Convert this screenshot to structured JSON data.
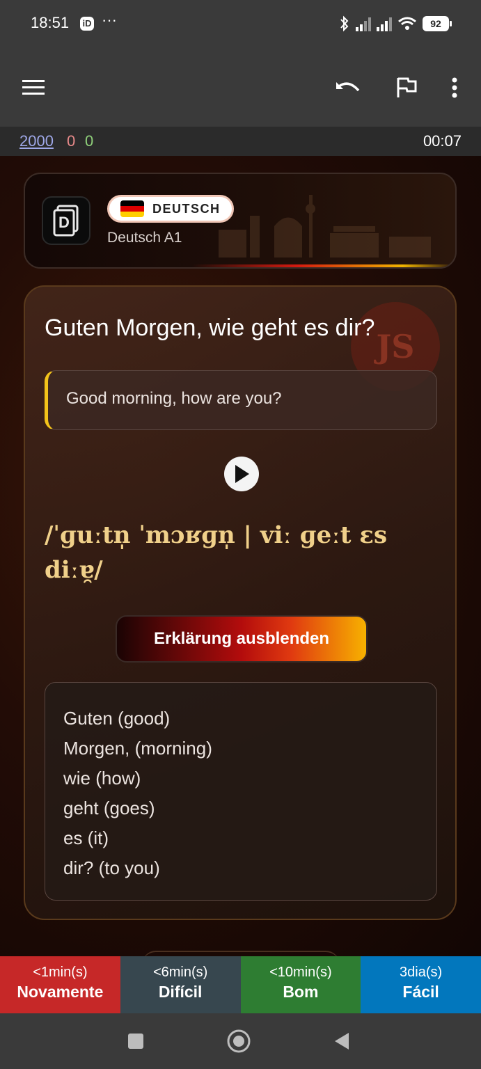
{
  "status_bar": {
    "time": "18:51",
    "app_badge": "iD",
    "more": "···",
    "battery": "92"
  },
  "app_bar": {
    "icons": [
      "menu-icon",
      "undo-icon",
      "flag-icon",
      "more-vert-icon"
    ]
  },
  "counters": {
    "new": "2000",
    "learning": "0",
    "review": "0",
    "timer": "00:07"
  },
  "deck": {
    "language": "DEUTSCH",
    "name": "Deutsch A1",
    "flag_colors": [
      "#000000",
      "#dd0000",
      "#ffce00"
    ]
  },
  "card": {
    "question": "Guten Morgen, wie geht es dir?",
    "translation": "Good morning, how are you?",
    "ipa": "/ˈɡuːtn̩ ˈmɔʁɡn̩ | viː ɡeːt ɛs diːɐ̯/",
    "toggle_label": "Erklärung ausblenden",
    "stamp": "JS",
    "breakdown": [
      "Guten (good)",
      "Morgen, (morning)",
      "wie (how)",
      "geht (goes)",
      "es (it)",
      "dir? (to you)"
    ]
  },
  "answers": [
    {
      "interval": "<1min(s)",
      "label": "Novamente",
      "color": "#c62828"
    },
    {
      "interval": "<6min(s)",
      "label": "Difícil",
      "color": "#37474f"
    },
    {
      "interval": "<10min(s)",
      "label": "Bom",
      "color": "#2e7d32"
    },
    {
      "interval": "3dia(s)",
      "label": "Fácil",
      "color": "#0277bd"
    }
  ]
}
